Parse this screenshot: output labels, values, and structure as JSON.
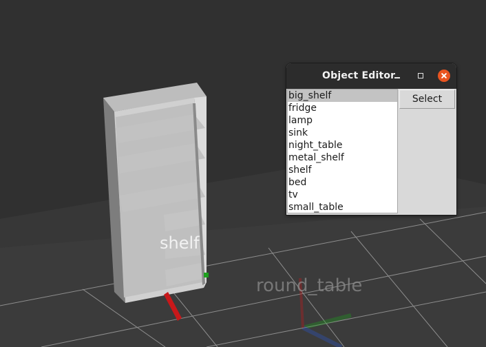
{
  "scene": {
    "labels": {
      "shelf_label": "shelf",
      "round_table_label": "round_table"
    },
    "colors": {
      "background": "#303030",
      "floor": "#3d3d3d",
      "grid": "#8a8a8a",
      "shelf_front": "#c9c9c9",
      "shelf_side": "#7f7f7f",
      "axis_x": "#c8181a",
      "axis_y": "#1ea01e",
      "axis_z": "#2a55c8"
    }
  },
  "window": {
    "title": "Object Editor",
    "controls": {
      "minimize_icon": "minimize-icon",
      "maximize_icon": "maximize-icon",
      "close_icon": "close-icon"
    },
    "list": {
      "items": [
        "big_shelf",
        "fridge",
        "lamp",
        "sink",
        "night_table",
        "metal_shelf",
        "shelf",
        "bed",
        "tv",
        "small_table"
      ],
      "selected": "big_shelf"
    },
    "select_label": "Select",
    "close_color": "#e95420"
  }
}
